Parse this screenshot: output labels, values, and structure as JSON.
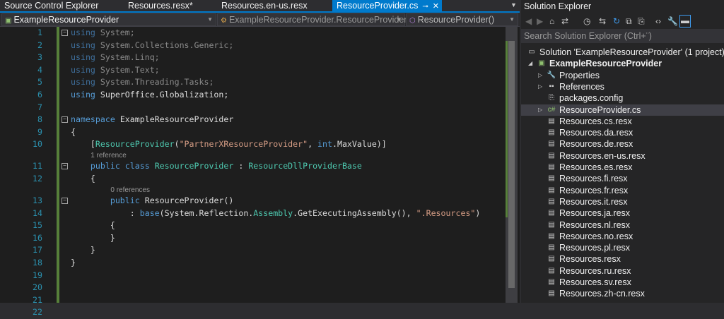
{
  "tabs": [
    {
      "label": "Source Control Explorer",
      "active": false
    },
    {
      "label": "Resources.resx*",
      "active": false
    },
    {
      "label": "Resources.en-us.resx",
      "active": false
    },
    {
      "label": "ResourceProvider.cs",
      "active": true
    }
  ],
  "nav": {
    "project": "ExampleResourceProvider",
    "class": "ExampleResourceProvider.ResourceProvider",
    "member": "ResourceProvider()"
  },
  "code": {
    "lines": [
      {
        "n": "1",
        "fold": true,
        "t": [
          [
            "using ",
            "dimkw"
          ],
          [
            "System;",
            "dim"
          ]
        ]
      },
      {
        "n": "2",
        "t": [
          [
            "using ",
            "dimkw"
          ],
          [
            "System.Collections.Generic;",
            "dim"
          ]
        ]
      },
      {
        "n": "3",
        "t": [
          [
            "using ",
            "dimkw"
          ],
          [
            "System.Linq;",
            "dim"
          ]
        ]
      },
      {
        "n": "4",
        "t": [
          [
            "using ",
            "dimkw"
          ],
          [
            "System.Text;",
            "dim"
          ]
        ]
      },
      {
        "n": "5",
        "t": [
          [
            "using ",
            "dimkw"
          ],
          [
            "System.Threading.Tasks;",
            "dim"
          ]
        ]
      },
      {
        "n": "6",
        "t": [
          [
            "using ",
            "kw"
          ],
          [
            "SuperOffice.Globalization;",
            ""
          ]
        ]
      },
      {
        "n": "7",
        "t": []
      },
      {
        "n": "8",
        "fold": true,
        "t": [
          [
            "namespace ",
            "kw"
          ],
          [
            "ExampleResourceProvider",
            ""
          ]
        ]
      },
      {
        "n": "9",
        "t": [
          [
            "{",
            ""
          ]
        ]
      },
      {
        "n": "10",
        "t": [
          [
            "    [",
            ""
          ],
          [
            "ResourceProvider",
            "ty"
          ],
          [
            "(",
            ""
          ],
          [
            "\"PartnerXResourceProvider\"",
            "st"
          ],
          [
            ", ",
            ""
          ],
          [
            "int",
            "kw"
          ],
          [
            ".MaxValue)]",
            ""
          ]
        ]
      },
      {
        "lens": "1 reference",
        "indent": 4
      },
      {
        "n": "11",
        "fold": true,
        "t": [
          [
            "    ",
            ""
          ],
          [
            "public ",
            "kw"
          ],
          [
            "class ",
            "kw"
          ],
          [
            "ResourceProvider",
            "ty"
          ],
          [
            " : ",
            ""
          ],
          [
            "ResourceDllProviderBase",
            "ty"
          ]
        ]
      },
      {
        "n": "12",
        "t": [
          [
            "    {",
            ""
          ]
        ]
      },
      {
        "lens": "0 references",
        "indent": 8
      },
      {
        "n": "13",
        "fold": true,
        "t": [
          [
            "        ",
            ""
          ],
          [
            "public ",
            "kw"
          ],
          [
            "ResourceProvider()",
            ""
          ]
        ]
      },
      {
        "n": "14",
        "t": [
          [
            "            : ",
            ""
          ],
          [
            "base",
            "kw"
          ],
          [
            "(System.Reflection.",
            ""
          ],
          [
            "Assembly",
            "ty"
          ],
          [
            ".GetExecutingAssembly(), ",
            ""
          ],
          [
            "\".Resources\"",
            "st"
          ],
          [
            ")",
            ""
          ]
        ]
      },
      {
        "n": "15",
        "t": [
          [
            "        {",
            ""
          ]
        ]
      },
      {
        "n": "16",
        "t": [
          [
            "        }",
            ""
          ]
        ]
      },
      {
        "n": "17",
        "t": [
          [
            "    }",
            ""
          ]
        ]
      },
      {
        "n": "18",
        "t": [
          [
            "}",
            ""
          ]
        ]
      },
      {
        "n": "19",
        "t": []
      },
      {
        "n": "20",
        "t": []
      },
      {
        "n": "21",
        "t": []
      },
      {
        "n": "22",
        "t": []
      }
    ]
  },
  "solution_explorer": {
    "title": "Solution Explorer",
    "search_placeholder": "Search Solution Explorer (Ctrl+¨)",
    "items": [
      {
        "label": "Solution 'ExampleResourceProvider' (1 project)",
        "depth": 0,
        "icon": "solution-icon",
        "glyph": "▭"
      },
      {
        "label": "ExampleResourceProvider",
        "depth": 1,
        "icon": "csharp-project-icon",
        "glyph": "▣",
        "bold": true,
        "arrow": "◢"
      },
      {
        "label": "Properties",
        "depth": 2,
        "icon": "wrench-icon",
        "glyph": "🔧",
        "arrow": "▷"
      },
      {
        "label": "References",
        "depth": 2,
        "icon": "references-icon",
        "glyph": "▪▪",
        "arrow": "▷"
      },
      {
        "label": "packages.config",
        "depth": 2,
        "icon": "config-file-icon",
        "glyph": "⎘"
      },
      {
        "label": "ResourceProvider.cs",
        "depth": 2,
        "icon": "csharp-file-icon",
        "glyph": "c#",
        "arrow": "▷",
        "selected": true
      },
      {
        "label": "Resources.cs.resx",
        "depth": 2,
        "icon": "resx-file-icon",
        "glyph": "▤"
      },
      {
        "label": "Resources.da.resx",
        "depth": 2,
        "icon": "resx-file-icon",
        "glyph": "▤"
      },
      {
        "label": "Resources.de.resx",
        "depth": 2,
        "icon": "resx-file-icon",
        "glyph": "▤"
      },
      {
        "label": "Resources.en-us.resx",
        "depth": 2,
        "icon": "resx-file-icon",
        "glyph": "▤"
      },
      {
        "label": "Resources.es.resx",
        "depth": 2,
        "icon": "resx-file-icon",
        "glyph": "▤"
      },
      {
        "label": "Resources.fi.resx",
        "depth": 2,
        "icon": "resx-file-icon",
        "glyph": "▤"
      },
      {
        "label": "Resources.fr.resx",
        "depth": 2,
        "icon": "resx-file-icon",
        "glyph": "▤"
      },
      {
        "label": "Resources.it.resx",
        "depth": 2,
        "icon": "resx-file-icon",
        "glyph": "▤"
      },
      {
        "label": "Resources.ja.resx",
        "depth": 2,
        "icon": "resx-file-icon",
        "glyph": "▤"
      },
      {
        "label": "Resources.nl.resx",
        "depth": 2,
        "icon": "resx-file-icon",
        "glyph": "▤"
      },
      {
        "label": "Resources.no.resx",
        "depth": 2,
        "icon": "resx-file-icon",
        "glyph": "▤"
      },
      {
        "label": "Resources.pl.resx",
        "depth": 2,
        "icon": "resx-file-icon",
        "glyph": "▤"
      },
      {
        "label": "Resources.resx",
        "depth": 2,
        "icon": "resx-file-icon",
        "glyph": "▤"
      },
      {
        "label": "Resources.ru.resx",
        "depth": 2,
        "icon": "resx-file-icon",
        "glyph": "▤"
      },
      {
        "label": "Resources.sv.resx",
        "depth": 2,
        "icon": "resx-file-icon",
        "glyph": "▤"
      },
      {
        "label": "Resources.zh-cn.resx",
        "depth": 2,
        "icon": "resx-file-icon",
        "glyph": "▤"
      }
    ]
  },
  "colors": {
    "accent": "#007acc",
    "keyword": "#569cd6",
    "type": "#4ec9b0",
    "string": "#d69d85",
    "line_number": "#2b91af",
    "change_bar": "#57803a"
  }
}
